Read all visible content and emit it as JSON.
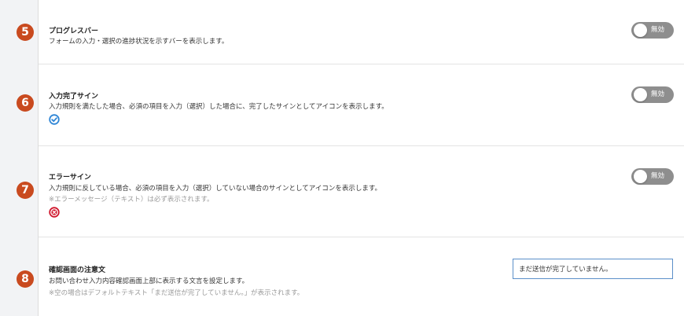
{
  "settings": [
    {
      "number": "5",
      "title": "プログレスバー",
      "description": "フォームの入力・選択の進捗状況を示すバーを表示します。",
      "toggle_label": "無効"
    },
    {
      "number": "6",
      "title": "入力完了サイン",
      "description": "入力規則を満たした場合、必須の項目を入力（選択）した場合に、完了したサインとしてアイコンを表示します。",
      "toggle_label": "無効",
      "icon": "check-circle-icon"
    },
    {
      "number": "7",
      "title": "エラーサイン",
      "description": "入力規則に反している場合、必須の項目を入力（選択）していない場合のサインとしてアイコンを表示します。",
      "note": "※エラーメッセージ（テキスト）は必ず表示されます。",
      "toggle_label": "無効",
      "icon": "error-x-circle-icon"
    },
    {
      "number": "8",
      "title": "確認画面の注意文",
      "description": "お問い合わせ入力内容確認画面上部に表示する文言を設定します。",
      "note": "※空の場合はデフォルトテキスト「まだ送信が完了していません。」が表示されます。",
      "input_value": "まだ送信が完了していません。"
    }
  ],
  "colors": {
    "number_badge": "#c94a1f",
    "toggle_off": "#8e8e8e",
    "check_icon": "#2f86d6",
    "error_icon": "#d0182d"
  }
}
